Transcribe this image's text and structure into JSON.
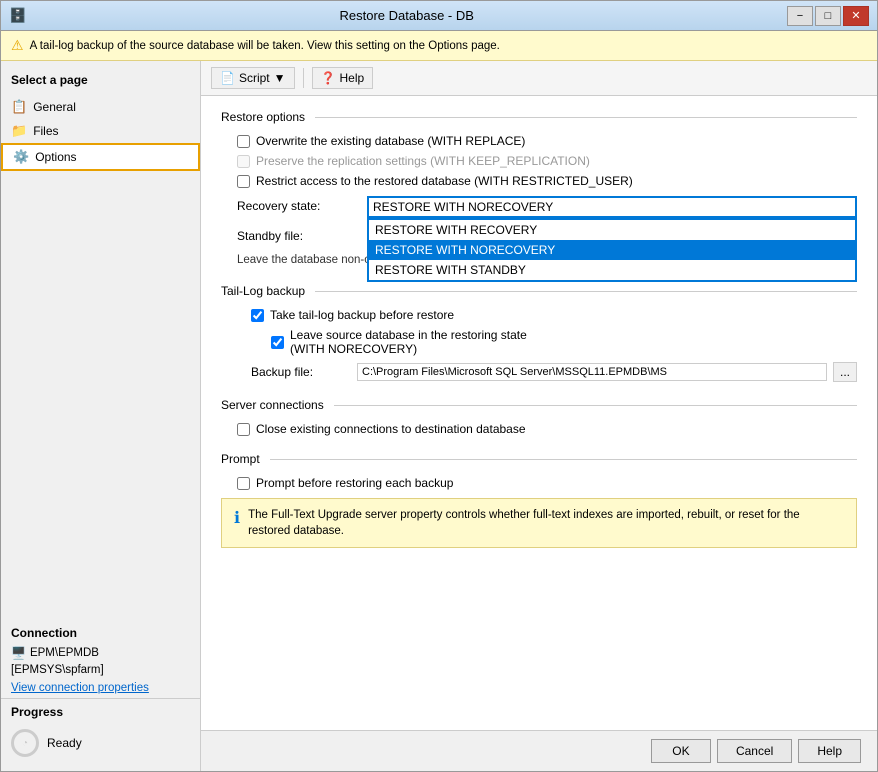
{
  "window": {
    "title": "Restore Database - DB",
    "warning": "A tail-log backup of the source database will be taken. View this setting on the Options page."
  },
  "toolbar": {
    "script_label": "Script",
    "help_label": "Help"
  },
  "sidebar": {
    "header": "Select a page",
    "items": [
      {
        "id": "general",
        "label": "General",
        "active": false
      },
      {
        "id": "files",
        "label": "Files",
        "active": false
      },
      {
        "id": "options",
        "label": "Options",
        "active": true
      }
    ]
  },
  "connection": {
    "header": "Connection",
    "server": "EPM\\EPMDB",
    "user": "[EPMSYS\\spfarm]",
    "view_link": "View connection properties"
  },
  "progress": {
    "header": "Progress",
    "status": "Ready"
  },
  "restore_options": {
    "section_label": "Restore options",
    "overwrite_label": "Overwrite the existing database (WITH REPLACE)",
    "preserve_label": "Preserve the replication settings (WITH KEEP_REPLICATION)",
    "restrict_label": "Restrict access to the restored database (WITH RESTRICTED_USER)",
    "recovery_label": "Recovery state:",
    "recovery_value": "RESTORE WITH NORECOVERY",
    "recovery_options": [
      {
        "value": "RESTORE WITH RECOVERY",
        "label": "RESTORE WITH RECOVERY"
      },
      {
        "value": "RESTORE WITH NORECOVERY",
        "label": "RESTORE WITH NORECOVERY",
        "selected": true
      },
      {
        "value": "RESTORE WITH STANDBY",
        "label": "RESTORE WITH STANDBY"
      }
    ],
    "standby_label": "Standby file:",
    "standby_value": "",
    "description": "Leave the database non-operational and do not roll back the uncommitted transactions. Additional transaction logs can be restored.",
    "description_short": "Leave the database non-operational an... can be restored."
  },
  "taillog": {
    "section_label": "Tail-Log backup",
    "take_backup_label": "Take tail-log backup before restore",
    "leave_source_label": "Leave source database in the restoring state",
    "leave_source_sub": "(WITH NORECOVERY)",
    "backup_file_label": "Backup file:",
    "backup_file_value": "C:\\Program Files\\Microsoft SQL Server\\MSSQL11.EPMDB\\MS"
  },
  "server_connections": {
    "section_label": "Server connections",
    "close_connections_label": "Close existing connections to destination database"
  },
  "prompt": {
    "section_label": "Prompt",
    "prompt_label": "Prompt before restoring each backup",
    "info_text": "The Full-Text Upgrade server property controls whether full-text indexes are imported, rebuilt, or reset for the restored database."
  },
  "footer": {
    "ok_label": "OK",
    "cancel_label": "Cancel",
    "help_label": "Help"
  }
}
